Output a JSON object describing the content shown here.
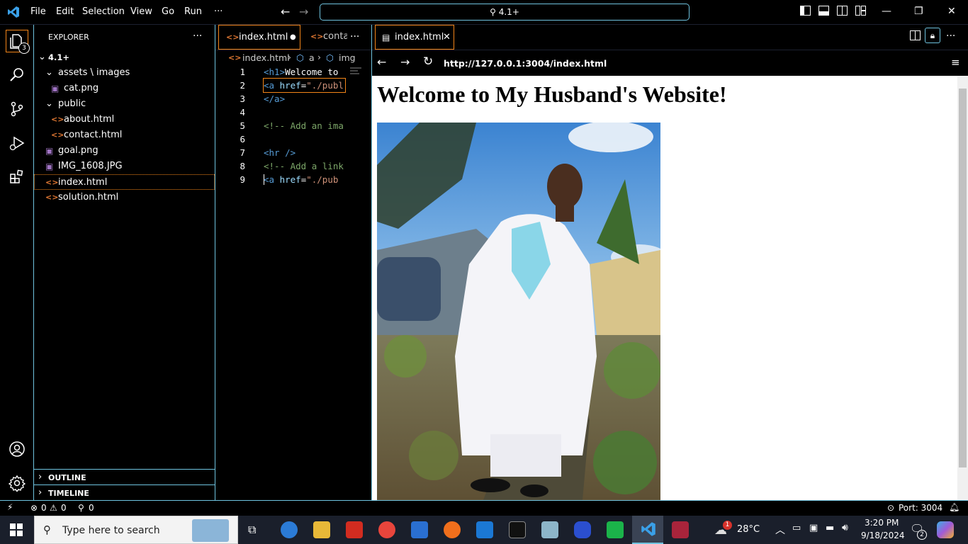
{
  "titlebar": {
    "menus": [
      "File",
      "Edit",
      "Selection",
      "View",
      "Go",
      "Run",
      "···"
    ],
    "search": "4.1+"
  },
  "activity": {
    "explorer_badge": "3"
  },
  "explorer": {
    "title": "EXPLORER",
    "more": "···",
    "root": "4.1+",
    "items": [
      {
        "label": "assets \\ images",
        "kind": "folder"
      },
      {
        "label": "cat.png",
        "kind": "image"
      },
      {
        "label": "public",
        "kind": "folder"
      },
      {
        "label": "about.html",
        "kind": "html"
      },
      {
        "label": "contact.html",
        "kind": "html"
      },
      {
        "label": "goal.png",
        "kind": "image"
      },
      {
        "label": "IMG_1608.JPG",
        "kind": "image"
      },
      {
        "label": "index.html",
        "kind": "html"
      },
      {
        "label": "solution.html",
        "kind": "html"
      }
    ],
    "outline": "OUTLINE",
    "timeline": "TIMELINE"
  },
  "editor": {
    "tab_active": "index.html",
    "tab_second": "conta",
    "tab_more": "···",
    "breadcrumb": [
      "index.html",
      "a",
      "img"
    ],
    "lines": [
      {
        "n": "1",
        "parts": [
          [
            "tag",
            "<h1>"
          ],
          [
            "txt",
            "Welcome to"
          ]
        ]
      },
      {
        "n": "2",
        "parts": [
          [
            "tag",
            "<a "
          ],
          [
            "attr",
            "href"
          ],
          [
            "txt",
            "="
          ],
          [
            "str",
            "\"./publ"
          ]
        ]
      },
      {
        "n": "3",
        "parts": [
          [
            "tag",
            "</a>"
          ]
        ]
      },
      {
        "n": "4",
        "parts": []
      },
      {
        "n": "5",
        "parts": [
          [
            "cmt",
            "<!-- Add an ima"
          ]
        ]
      },
      {
        "n": "6",
        "parts": []
      },
      {
        "n": "7",
        "parts": [
          [
            "tag",
            "<hr />"
          ]
        ]
      },
      {
        "n": "8",
        "parts": [
          [
            "cmt",
            "<!-- Add a link"
          ]
        ]
      },
      {
        "n": "9",
        "parts": [
          [
            "txt",
            " "
          ],
          [
            "tag",
            "<a "
          ],
          [
            "attr",
            "href"
          ],
          [
            "txt",
            "="
          ],
          [
            "str",
            "\"./pub"
          ]
        ]
      }
    ]
  },
  "preview": {
    "tab": "index.html",
    "url": "http://127.0.0.1:3004/index.html",
    "heading": "Welcome to My Husband's Website!"
  },
  "status": {
    "errors": "0",
    "warnings": "0",
    "ports": "0",
    "port_label": "Port: 3004"
  },
  "taskbar": {
    "search_placeholder": "Type here to search",
    "temperature": "28°C",
    "time": "3:20 PM",
    "date": "9/18/2024",
    "notifications": "2",
    "weather_badge": "1"
  }
}
